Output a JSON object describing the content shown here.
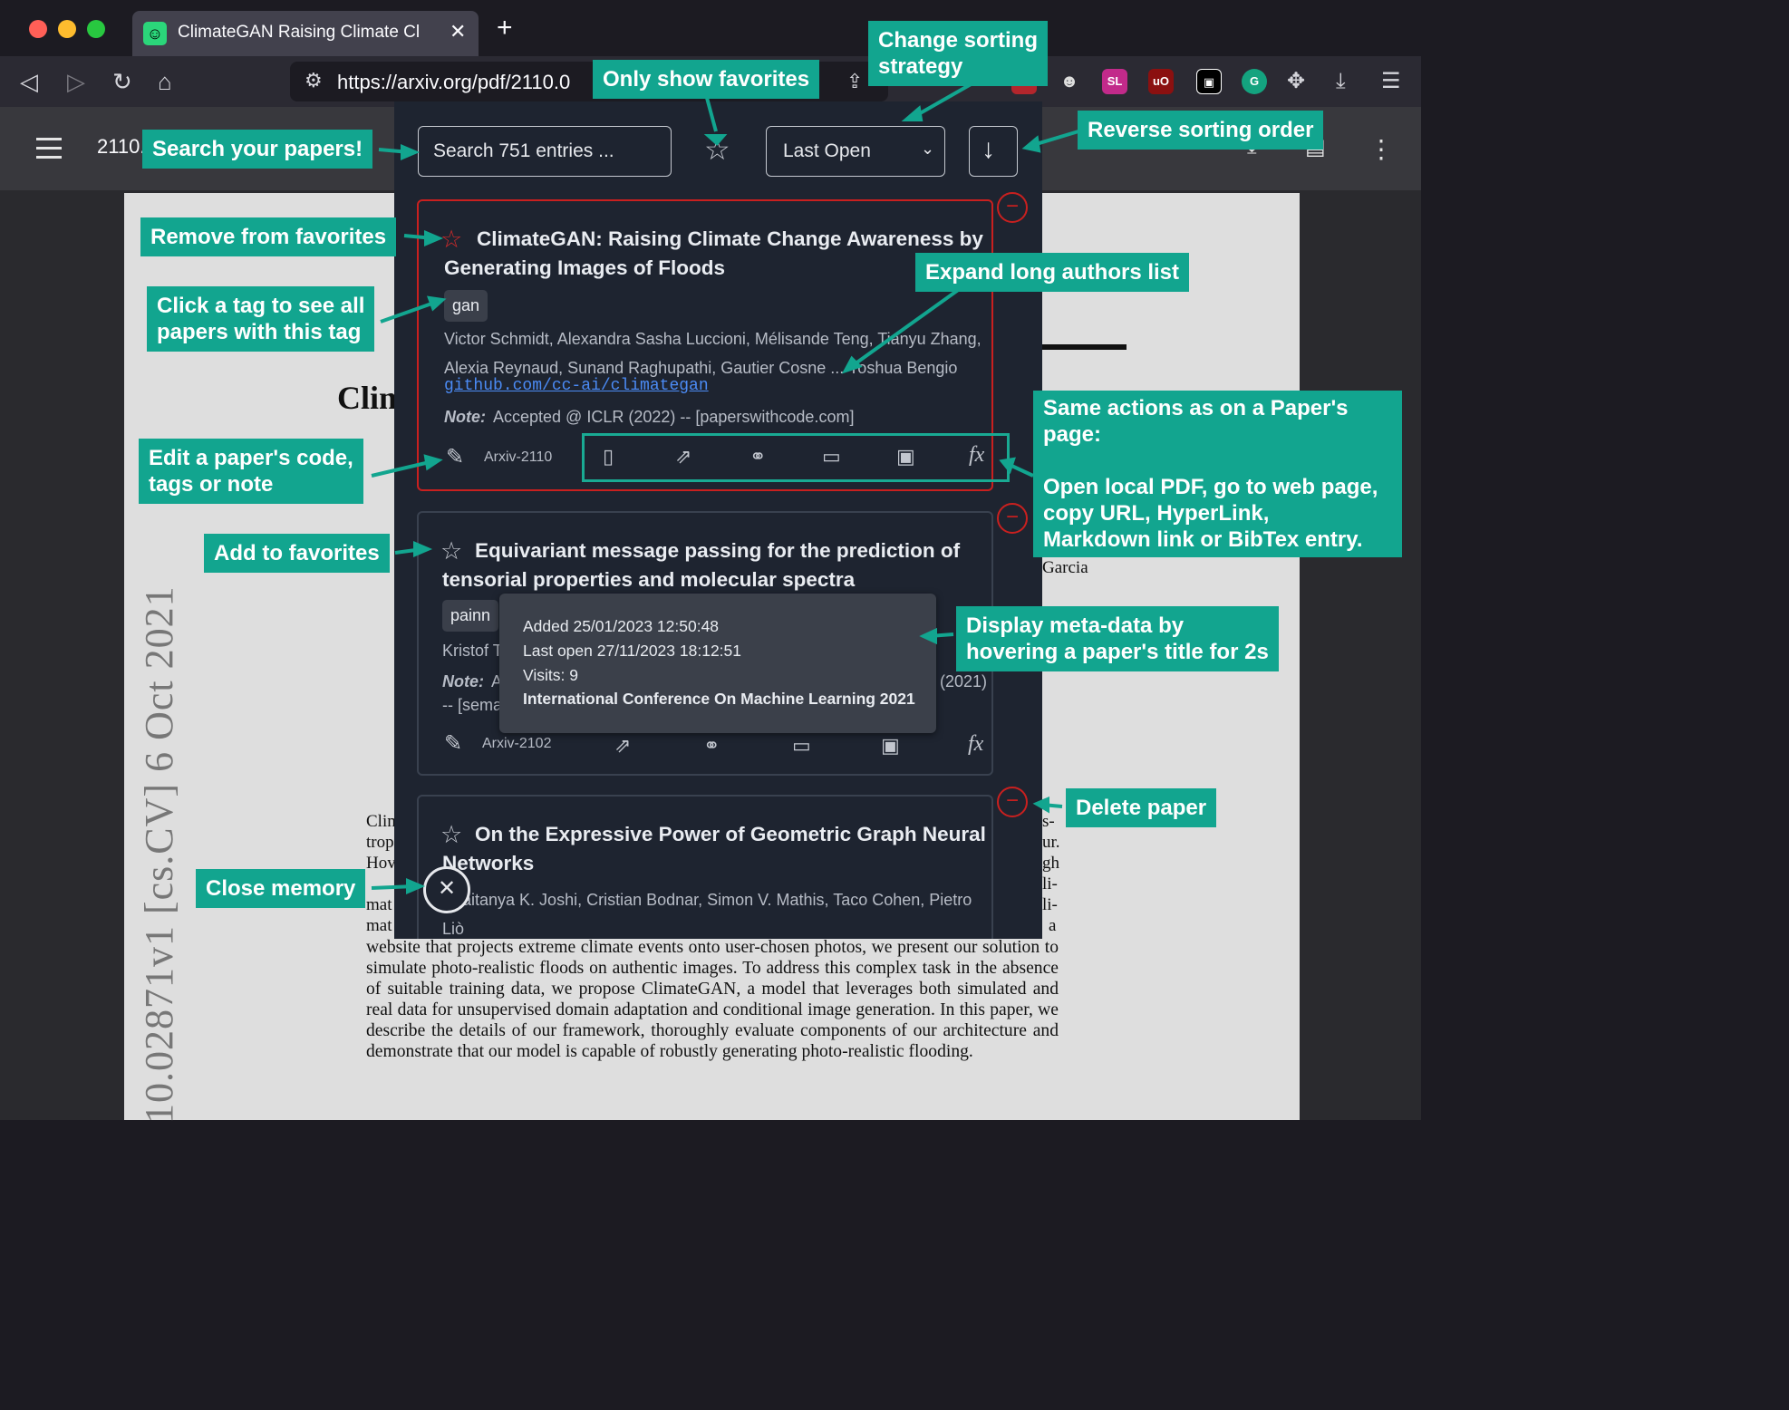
{
  "browser": {
    "tab_title": "ClimateGAN Raising Climate Cl",
    "tab_favicon": "☺",
    "url": "https://arxiv.org/pdf/2110.0",
    "extensions": [
      "SL",
      "uO",
      "G"
    ]
  },
  "pdf_viewer": {
    "doc_id": "2110.",
    "side_label": "10.02871v1   [cs.CV]   6 Oct 2021",
    "title_fragment": "Clim",
    "author_fragment": "Garcia",
    "abstract_fragments": [
      "Clim",
      "trop",
      "Hov",
      "mat",
      "mat",
      "s-",
      "ur.",
      "gh",
      "li-",
      "li-",
      "a"
    ],
    "abstract_lines": "website that projects extreme climate events onto user-chosen photos, we present our solution to simulate photo-realistic floods on authentic images. To address this complex task in the absence of suitable training data, we propose ClimateGAN, a model that leverages both simulated and real data for unsupervised domain adaptation and conditional image generation. In this paper, we describe the details of our framework, thoroughly evaluate components of our architecture and demonstrate that our model is capable of robustly generating photo-realistic flooding."
  },
  "memory": {
    "search_placeholder": "Search 751 entries ...",
    "sort_value": "Last Open",
    "papers": [
      {
        "title": "ClimateGAN: Raising Climate Change Awareness by Generating Images of Floods",
        "tag": "gan",
        "authors": "Victor Schmidt, Alexandra Sasha Luccioni, Mélisande Teng, Tianyu Zhang, Alexia Reynaud, Sunand Raghupathi, Gautier Cosne ... Yoshua Bengio",
        "link": "github.com/cc-ai/climategan",
        "note_label": "Note:",
        "note": "Accepted @ ICLR (2022) -- [paperswithcode.com]",
        "code": "Arxiv-2110",
        "favorite": true
      },
      {
        "title": "Equivariant message passing for the prediction of tensorial properties and molecular spectra",
        "tag": "painn",
        "authors_fragment": "Kristof T",
        "note_label": "Note:",
        "note_fragment": "A",
        "note_tail": "(2021)",
        "note_line2": "-- [sema",
        "code": "Arxiv-2102",
        "favorite": false
      },
      {
        "title": "On the Expressive Power of Geometric Graph Neural Networks",
        "authors": "aitanya K. Joshi, Cristian Bodnar, Simon V. Mathis, Taco Cohen, Pietro Liò",
        "favorite": false
      }
    ],
    "tooltip": {
      "added": "Added 25/01/2023 12:50:48",
      "last_open": "Last open 27/11/2023 18:12:51",
      "visits": "Visits: 9",
      "venue": "International Conference On Machine Learning 2021"
    },
    "icons": {
      "favorite_on": "star-filled-red-icon",
      "favorite_off": "star-outline-icon",
      "code": "edit-code-icon",
      "actions": [
        "open-local-pdf-icon",
        "open-web-page-icon",
        "copy-url-icon",
        "hyperlink-icon",
        "markdown-link-icon",
        "bibtex-icon"
      ]
    }
  },
  "callouts": {
    "only_favorites": "Only show favorites",
    "change_sorting": "Change sorting\nstrategy",
    "search": "Search your papers!",
    "reverse": "Reverse sorting order",
    "remove_fav": "Remove from favorites",
    "click_tag": "Click a tag to see all\npapers with this tag",
    "expand_authors": "Expand long authors list",
    "same_actions": "Same actions as on a Paper's\npage:\n\nOpen local PDF, go to web page,\ncopy URL, HyperLink,\nMarkdown link or BibTex entry.",
    "edit_code": "Edit a paper's code,\ntags or note",
    "add_fav": "Add to favorites",
    "metadata": "Display meta-data by\nhovering a paper's title for 2s",
    "delete": "Delete paper",
    "close_memory": "Close memory"
  },
  "colors": {
    "callout_bg": "#12a58f",
    "popup_bg": "#1e2430",
    "delete_red": "#c9201f",
    "link_blue": "#4b8bf5"
  }
}
